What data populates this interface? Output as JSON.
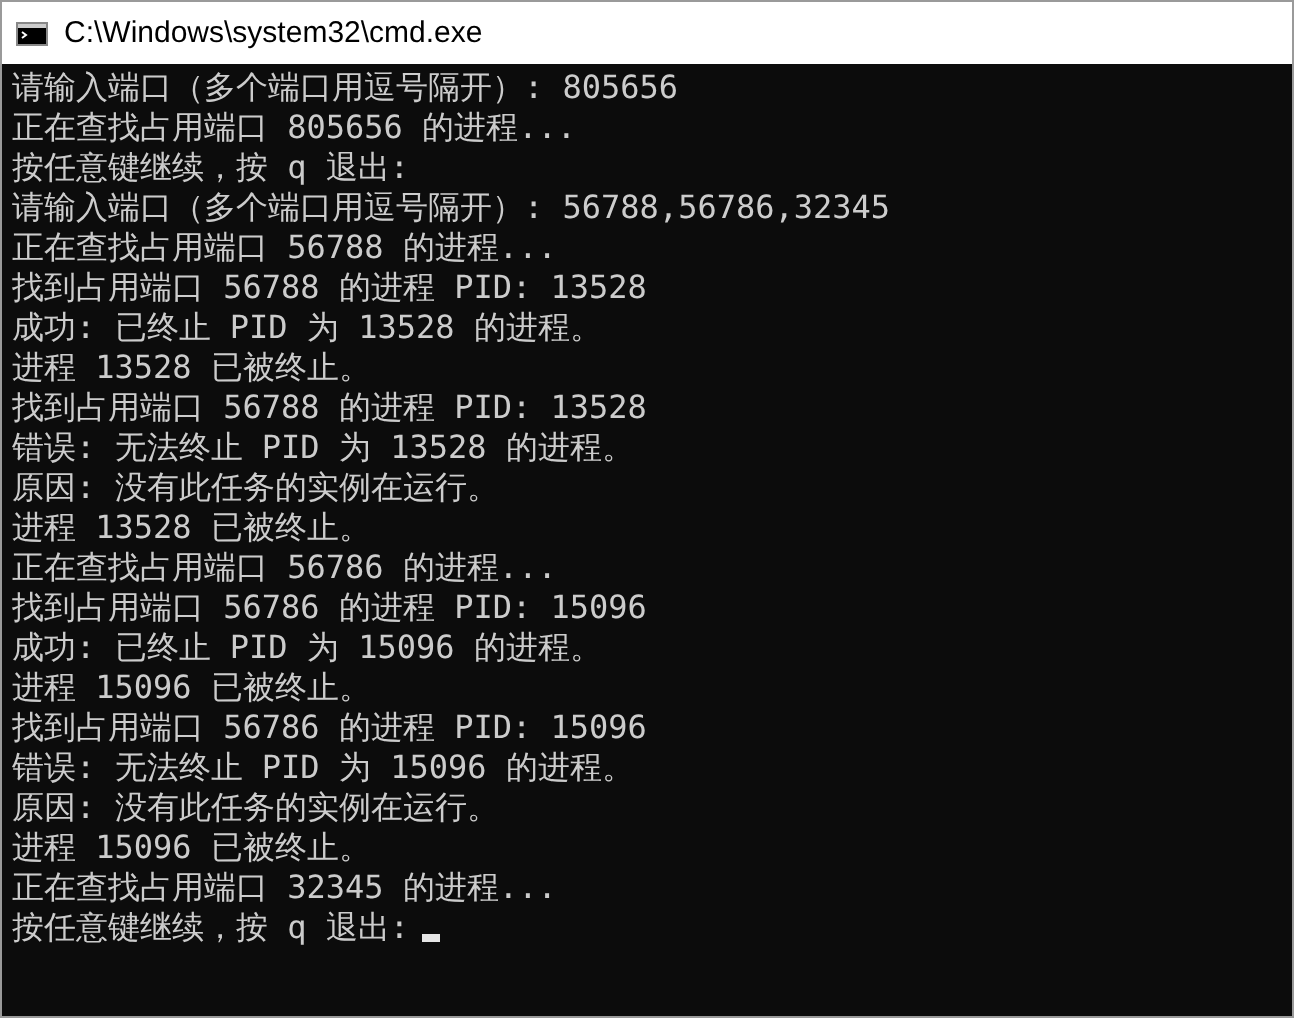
{
  "window": {
    "title": "C:\\Windows\\system32\\cmd.exe"
  },
  "console": {
    "lines": [
      "请输入端口（多个端口用逗号隔开）: 805656",
      "正在查找占用端口 805656 的进程...",
      "按任意键继续，按 q 退出:",
      "请输入端口（多个端口用逗号隔开）: 56788,56786,32345",
      "正在查找占用端口 56788 的进程...",
      "找到占用端口 56788 的进程 PID: 13528",
      "成功: 已终止 PID 为 13528 的进程。",
      "进程 13528 已被终止。",
      "找到占用端口 56788 的进程 PID: 13528",
      "错误: 无法终止 PID 为 13528 的进程。",
      "原因: 没有此任务的实例在运行。",
      "进程 13528 已被终止。",
      "正在查找占用端口 56786 的进程...",
      "找到占用端口 56786 的进程 PID: 15096",
      "成功: 已终止 PID 为 15096 的进程。",
      "进程 15096 已被终止。",
      "找到占用端口 56786 的进程 PID: 15096",
      "错误: 无法终止 PID 为 15096 的进程。",
      "原因: 没有此任务的实例在运行。",
      "进程 15096 已被终止。",
      "正在查找占用端口 32345 的进程...",
      "按任意键继续，按 q 退出:"
    ],
    "cursor": true
  }
}
